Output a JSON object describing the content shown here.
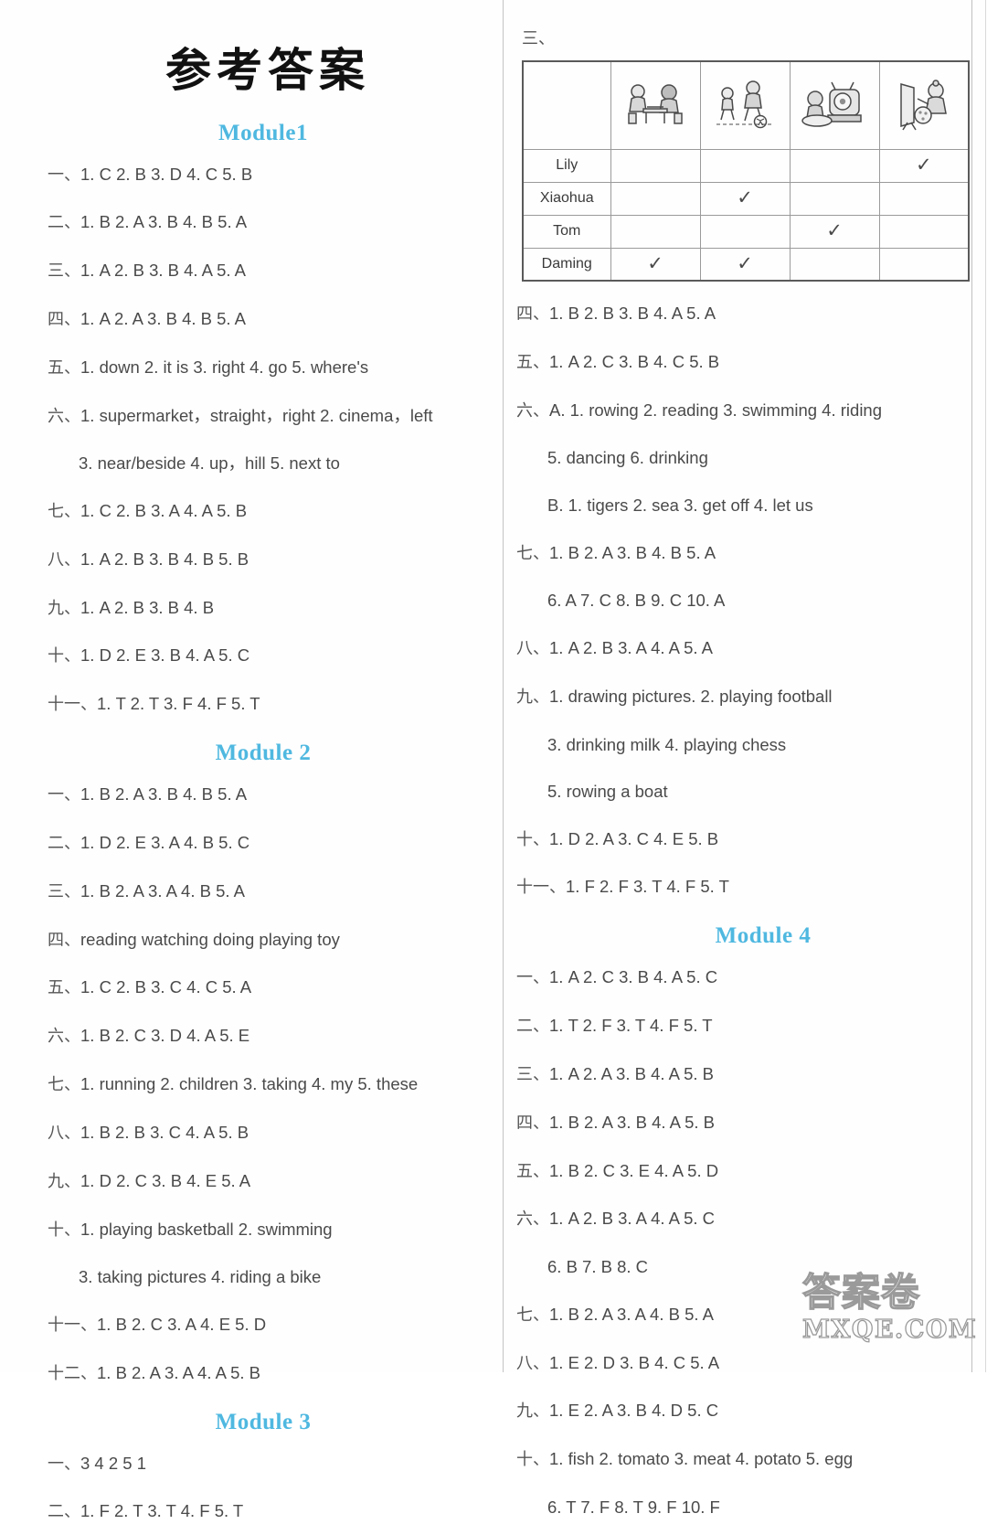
{
  "document": {
    "title": "参考答案",
    "accent_color": "#4fb8e0",
    "watermark": {
      "cn": "答案卷",
      "url": "MXQE.COM"
    }
  },
  "left_column": {
    "modules": [
      {
        "heading": "Module1",
        "lines": [
          {
            "marker": "一、",
            "text": "1. C  2. B  3. D  4. C  5. B",
            "indent": false
          },
          {
            "marker": "二、",
            "text": "1. B  2. A  3. B  4. B  5. A",
            "indent": false
          },
          {
            "marker": "三、",
            "text": "1. A  2. B  3. B  4. A  5. A",
            "indent": false
          },
          {
            "marker": "四、",
            "text": "1. A  2. A  3. B  4. B  5. A",
            "indent": false
          },
          {
            "marker": "五、",
            "text": "1. down  2. it is  3. right  4. go  5. where's",
            "indent": false
          },
          {
            "marker": "六、",
            "text": "1. supermarket，straight，right  2. cinema，left",
            "indent": false
          },
          {
            "marker": "",
            "text": "3. near/beside  4. up，hill  5. next to",
            "indent": true
          },
          {
            "marker": "七、",
            "text": "1. C  2. B  3. A  4. A  5. B",
            "indent": false
          },
          {
            "marker": "八、",
            "text": "1. A  2. B  3. B  4. B  5. B",
            "indent": false
          },
          {
            "marker": "九、",
            "text": "1. A  2. B  3. B  4. B",
            "indent": false
          },
          {
            "marker": "十、",
            "text": "1. D  2. E  3. B  4. A  5. C",
            "indent": false
          },
          {
            "marker": "十一、",
            "text": "1. T  2. T  3. F  4. F  5. T",
            "indent": false
          }
        ]
      },
      {
        "heading": "Module 2",
        "lines": [
          {
            "marker": "一、",
            "text": "1. B  2. A  3. B  4. B  5. A",
            "indent": false
          },
          {
            "marker": "二、",
            "text": "1. D  2. E  3. A  4. B  5. C",
            "indent": false
          },
          {
            "marker": "三、",
            "text": "1. B  2. A  3. A  4. B  5. A",
            "indent": false
          },
          {
            "marker": "四、",
            "text": "reading  watching  doing  playing  toy",
            "indent": false
          },
          {
            "marker": "五、",
            "text": "1. C  2. B  3. C  4. C  5. A",
            "indent": false
          },
          {
            "marker": "六、",
            "text": "1. B  2. C  3. D  4. A  5. E",
            "indent": false
          },
          {
            "marker": "七、",
            "text": "1. running  2. children  3. taking  4. my  5. these",
            "indent": false
          },
          {
            "marker": "八、",
            "text": "1. B  2. B  3. C  4. A  5. B",
            "indent": false
          },
          {
            "marker": "九、",
            "text": "1. D  2. C  3. B  4. E  5. A",
            "indent": false
          },
          {
            "marker": "十、",
            "text": "1. playing basketball  2. swimming",
            "indent": false
          },
          {
            "marker": "",
            "text": "3. taking pictures  4. riding a bike",
            "indent": true
          },
          {
            "marker": "十一、",
            "text": "1. B  2. C  3. A  4. E  5. D",
            "indent": false
          },
          {
            "marker": "十二、",
            "text": "1. B  2. A  3. A  4. A  5. B",
            "indent": false
          }
        ]
      },
      {
        "heading": "Module 3",
        "lines": [
          {
            "marker": "一、",
            "text": "3   4   2   5   1",
            "indent": false
          },
          {
            "marker": "二、",
            "text": "1. F  2. T  3. T  4. F  5. T",
            "indent": false
          }
        ]
      }
    ]
  },
  "right_column": {
    "section_marker": "三、",
    "table": {
      "columns": [
        {
          "icon": "playing-chess-icon",
          "label": "playing chess"
        },
        {
          "icon": "playing-football-icon",
          "label": "playing football"
        },
        {
          "icon": "watching-tv-icon",
          "label": "watching TV"
        },
        {
          "icon": "drawing-pictures-icon",
          "label": "drawing pictures"
        }
      ],
      "rows": [
        {
          "name": "Lily",
          "checks": [
            false,
            false,
            false,
            true
          ]
        },
        {
          "name": "Xiaohua",
          "checks": [
            false,
            true,
            false,
            false
          ]
        },
        {
          "name": "Tom",
          "checks": [
            false,
            false,
            true,
            false
          ]
        },
        {
          "name": "Daming",
          "checks": [
            true,
            true,
            false,
            false
          ]
        }
      ],
      "tick_glyph": "✓"
    },
    "module3_continued": [
      {
        "marker": "四、",
        "text": "1. B  2. B  3. B  4. A  5. A",
        "indent": false
      },
      {
        "marker": "五、",
        "text": "1. A  2. C  3. B  4. C  5. B",
        "indent": false
      },
      {
        "marker": "六、",
        "text": "A. 1. rowing  2. reading  3. swimming  4. riding",
        "indent": false
      },
      {
        "marker": "",
        "text": "5. dancing  6. drinking",
        "indent": true
      },
      {
        "marker": "",
        "text": "B. 1. tigers  2. sea  3. get off  4. let us",
        "indent": true
      },
      {
        "marker": "七、",
        "text": "1. B  2. A  3. B  4. B  5. A",
        "indent": false
      },
      {
        "marker": "",
        "text": "6. A  7. C  8. B  9. C  10. A",
        "indent": true
      },
      {
        "marker": "八、",
        "text": "1. A  2. B  3. A  4. A  5. A",
        "indent": false
      },
      {
        "marker": "九、",
        "text": "1. drawing pictures.   2. playing football",
        "indent": false
      },
      {
        "marker": "",
        "text": "3. drinking milk  4. playing chess",
        "indent": true
      },
      {
        "marker": "",
        "text": "5. rowing a boat",
        "indent": true
      },
      {
        "marker": "十、",
        "text": "1. D  2. A  3. C  4. E  5. B",
        "indent": false
      },
      {
        "marker": "十一、",
        "text": "1. F  2. F  3. T  4. F  5. T",
        "indent": false
      }
    ],
    "modules": [
      {
        "heading": "Module 4",
        "lines": [
          {
            "marker": "一、",
            "text": "1. A  2. C  3. B  4. A  5. C",
            "indent": false
          },
          {
            "marker": "二、",
            "text": "1. T  2. F  3. T  4. F  5. T",
            "indent": false
          },
          {
            "marker": "三、",
            "text": "1. A  2. A  3. B  4. A  5. B",
            "indent": false
          },
          {
            "marker": "四、",
            "text": "1. B  2. A  3. B  4. A  5. B",
            "indent": false
          },
          {
            "marker": "五、",
            "text": "1. B  2. C  3. E  4. A  5. D",
            "indent": false
          },
          {
            "marker": "六、",
            "text": "1. A  2. B  3. A  4. A  5. C",
            "indent": false
          },
          {
            "marker": "",
            "text": "6. B  7. B  8. C",
            "indent": true
          },
          {
            "marker": "七、",
            "text": "1. B  2. A  3. A  4. B  5. A",
            "indent": false
          },
          {
            "marker": "八、",
            "text": "1. E  2. D  3. B  4. C  5. A",
            "indent": false
          },
          {
            "marker": "九、",
            "text": "1. E  2. A  3. B  4. D  5. C",
            "indent": false
          },
          {
            "marker": "十、",
            "text": "1. fish  2. tomato  3. meat  4. potato  5. egg",
            "indent": false
          },
          {
            "marker": "",
            "text": "6. T  7. F  8. T  9. F  10. F",
            "indent": true
          }
        ]
      }
    ]
  }
}
